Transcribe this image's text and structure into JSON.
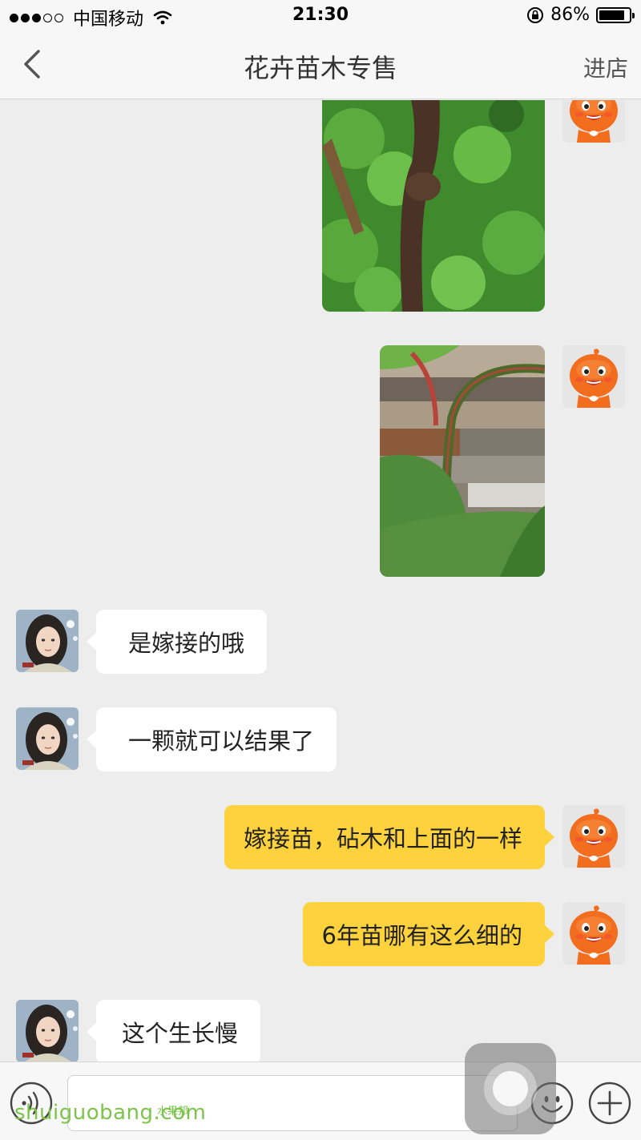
{
  "status_bar": {
    "carrier": "中国移动",
    "time": "21:30",
    "battery": "86%",
    "battery_level": 0.86
  },
  "nav": {
    "title": "花卉苗木专售",
    "shop_link": "进店"
  },
  "messages": [
    {
      "from": "seller",
      "type": "image",
      "image": "plant-stem-clover-photo"
    },
    {
      "from": "seller",
      "type": "image",
      "image": "plant-stem-leaf-photo"
    },
    {
      "from": "user",
      "type": "text",
      "text": "是嫁接的哦"
    },
    {
      "from": "user",
      "type": "text",
      "text": "一颗就可以结果了"
    },
    {
      "from": "seller",
      "type": "text",
      "text": "嫁接苗，砧木和上面的一样"
    },
    {
      "from": "seller",
      "type": "text",
      "text": "6年苗哪有这么细的"
    },
    {
      "from": "user",
      "type": "text",
      "text": "这个生长慢"
    }
  ],
  "input_bar": {
    "placeholder": ""
  },
  "watermark": {
    "main": "shuiguobang.com",
    "sub": "水果邦"
  },
  "colors": {
    "seller_bubble": "#fdd23c",
    "user_bubble": "#ffffff",
    "background": "#ededed",
    "mascot_orange": "#f26d1d"
  }
}
